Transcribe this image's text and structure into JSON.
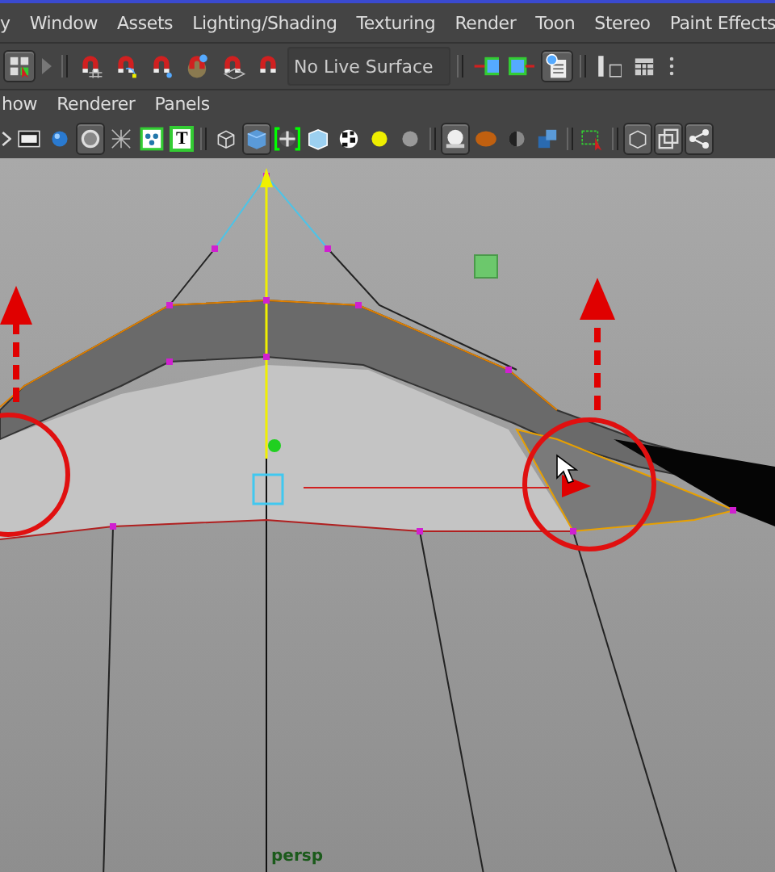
{
  "menu_bar": [
    {
      "label": "y"
    },
    {
      "label": "Window"
    },
    {
      "label": "Assets"
    },
    {
      "label": "Lighting/Shading"
    },
    {
      "label": "Texturing"
    },
    {
      "label": "Render"
    },
    {
      "label": "Toon"
    },
    {
      "label": "Stereo"
    },
    {
      "label": "Paint Effects"
    }
  ],
  "status_line": {
    "tools": [
      {
        "kind": "layout",
        "selected": true
      },
      {
        "kind": "expander",
        "selected": false
      },
      {
        "kind": "separator"
      },
      {
        "kind": "magnet-grid",
        "selected": false
      },
      {
        "kind": "magnet-curve",
        "selected": false
      },
      {
        "kind": "magnet-point",
        "selected": false
      },
      {
        "kind": "magnet-view",
        "selected": false
      },
      {
        "kind": "magnet-plane",
        "selected": false
      },
      {
        "kind": "magnet",
        "selected": false
      },
      {
        "kind": "field",
        "label": "No Live Surface"
      },
      {
        "kind": "separator"
      },
      {
        "kind": "input",
        "selected": false
      },
      {
        "kind": "output",
        "selected": false
      },
      {
        "kind": "history",
        "selected": true
      },
      {
        "kind": "separator"
      },
      {
        "kind": "attributes",
        "selected": false
      },
      {
        "kind": "channels",
        "selected": false
      },
      {
        "kind": "more",
        "selected": false
      }
    ]
  },
  "panel_menu": [
    {
      "label": "how"
    },
    {
      "label": "Renderer"
    },
    {
      "label": "Panels"
    }
  ],
  "panel_toolbar": [
    {
      "kind": "expand",
      "selected": false
    },
    {
      "kind": "film",
      "selected": false
    },
    {
      "kind": "blue-sphere",
      "selected": false
    },
    {
      "kind": "ring",
      "selected": true
    },
    {
      "kind": "cross",
      "selected": false
    },
    {
      "kind": "nodes",
      "selected": false
    },
    {
      "kind": "text",
      "label": "T",
      "selected": false
    },
    {
      "kind": "separator"
    },
    {
      "kind": "wire-cube",
      "selected": false
    },
    {
      "kind": "shaded-cube",
      "selected": true
    },
    {
      "kind": "bracket-ball",
      "selected": false
    },
    {
      "kind": "light-cube",
      "selected": false
    },
    {
      "kind": "checker-ball",
      "selected": false
    },
    {
      "kind": "glow",
      "selected": false
    },
    {
      "kind": "grey-sphere",
      "selected": false
    },
    {
      "kind": "separator"
    },
    {
      "kind": "white-sphere",
      "selected": true
    },
    {
      "kind": "orange-ball",
      "selected": false
    },
    {
      "kind": "half-sphere",
      "selected": false
    },
    {
      "kind": "blue-cubes",
      "selected": false
    },
    {
      "kind": "separator"
    },
    {
      "kind": "select-box",
      "selected": false
    },
    {
      "kind": "separator"
    },
    {
      "kind": "cube-outline",
      "selected": true
    },
    {
      "kind": "squares",
      "selected": true
    },
    {
      "kind": "share",
      "selected": true
    }
  ],
  "viewport": {
    "camera_label": "persp"
  }
}
